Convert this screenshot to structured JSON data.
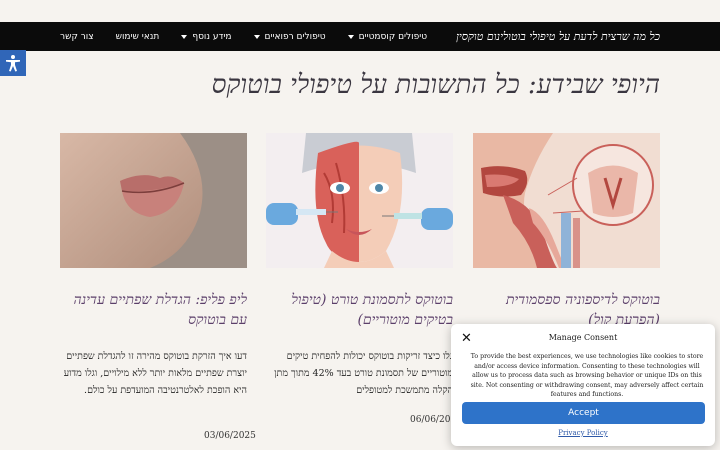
{
  "header": {
    "site_title": "כל מה שרצית לדעת על טיפולי בוטולינום טוקסין",
    "nav": [
      {
        "label": "טיפולים קוסמטיים",
        "has_dropdown": true
      },
      {
        "label": "טיפולים רפואיים",
        "has_dropdown": true
      },
      {
        "label": "מידע נוסף",
        "has_dropdown": true
      },
      {
        "label": "תנאי שימוש",
        "has_dropdown": false
      },
      {
        "label": "צור קשר",
        "has_dropdown": false
      }
    ]
  },
  "accessibility": {
    "icon": "accessibility-icon",
    "color": "#3066b8"
  },
  "page": {
    "title": "היופי שבידע: כל התשובות על טיפולי בוטוקס"
  },
  "posts": [
    {
      "title": "בוטוקס לדיספוניה ספסמודית (הפרעת קול)",
      "excerpt": "",
      "date": ""
    },
    {
      "title": "בוטוקס לתסמונת טורט (טיפול בטיקים מוטוריים)",
      "excerpt": "גלו כיצד זריקות בוטוקס יכולות להפחית טיקים מוטוריים של תסמונת טורט בעד 42% מתוך מתן הקלה מתמשכת למטופלים",
      "date": "06/06/2025"
    },
    {
      "title": "ליפ פליפ: הגדלת שפתיים עדינה עם בוטוקס",
      "excerpt": "דעו איך הזרקת בוטוקס מהירה זו להגדלת שפתיים יוצרת שפתיים מלאות יותר ללא מילויים, וגלו מדוע היא הופכת לאלטרנטיבה המועדפת על כולם.",
      "date": "03/06/2025"
    }
  ],
  "consent": {
    "title": "Manage Consent",
    "text": "To provide the best experiences, we use technologies like cookies to store and/or access device information. Consenting to these technologies will allow us to process data such as browsing behavior or unique IDs on this site. Not consenting or withdrawing consent, may adversely affect certain features and functions.",
    "accept_label": "Accept",
    "policy_link": "Privacy Policy",
    "accent": "#2e73c9"
  }
}
